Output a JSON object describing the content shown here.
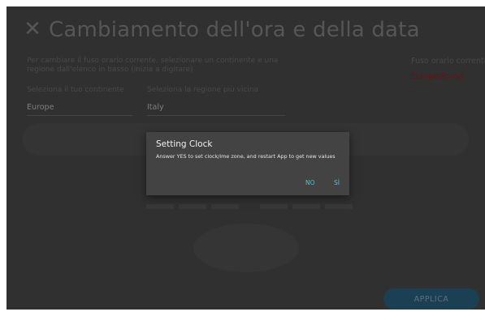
{
  "screen": {
    "title": "Cambiamento dell'ora e della data",
    "description": "Per cambiare il fuso orario corrente, selezionare un continente e una regione dall'elenco in basso (inizia a digitare)",
    "timezone_label": "Fuso orario corrente",
    "timezone_value": "Europe/Rome",
    "continent_label": "Seleziona il tuo continente",
    "continent_value": "Europe",
    "region_label": "Seleziona la regione più vicina",
    "region_value": "Italy",
    "apply_label": "APPLICA",
    "icons": {
      "close": "close-icon"
    }
  },
  "dialog": {
    "title": "Setting Clock",
    "message": "Answer YES to set clock/ime zone, and restart App to get new values",
    "no_label": "NO",
    "yes_label": "SÌ"
  },
  "colors": {
    "accent_teal": "#6ab7c2",
    "timezone_red": "#7a1818",
    "apply_blue": "#224e66"
  }
}
